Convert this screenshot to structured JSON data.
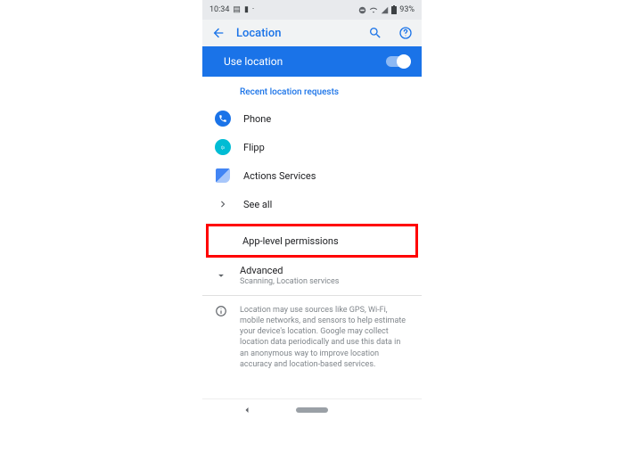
{
  "status": {
    "time": "10:34",
    "battery": "93%"
  },
  "appbar": {
    "title": "Location"
  },
  "toggle": {
    "label": "Use location"
  },
  "section_header": "Recent location requests",
  "apps": {
    "phone": "Phone",
    "flipp": "Flipp",
    "actions": "Actions Services",
    "see_all": "See all"
  },
  "permissions": {
    "label": "App-level permissions"
  },
  "advanced": {
    "label": "Advanced",
    "sub": "Scanning, Location services"
  },
  "info": {
    "text": "Location may use sources like GPS, Wi-Fi, mobile networks, and sensors to help estimate your device's location. Google may collect location data periodically and use this data in an anonymous way to improve location accuracy and location-based services."
  }
}
